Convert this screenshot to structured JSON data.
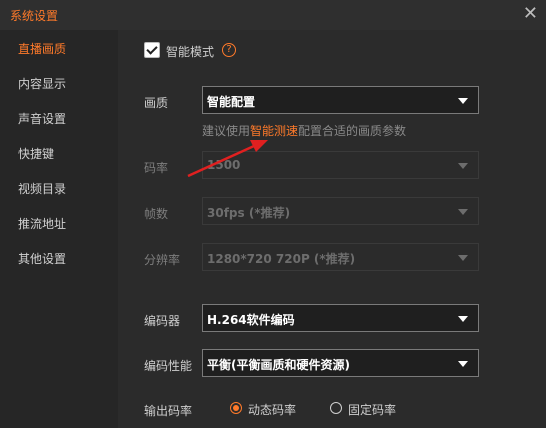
{
  "window": {
    "title": "系统设置",
    "close_glyph": "✕"
  },
  "sidebar": {
    "items": [
      {
        "label": "直播画质",
        "active": true
      },
      {
        "label": "内容显示"
      },
      {
        "label": "声音设置"
      },
      {
        "label": "快捷键"
      },
      {
        "label": "视频目录"
      },
      {
        "label": "推流地址"
      },
      {
        "label": "其他设置"
      }
    ]
  },
  "smart_mode": {
    "label": "智能模式",
    "checked": true,
    "help_glyph": "?"
  },
  "quality": {
    "label": "画质",
    "value": "智能配置",
    "hint_prefix": "建议使用",
    "hint_link": "智能测速",
    "hint_suffix": "配置合适的画质参数"
  },
  "bitrate": {
    "label": "码率",
    "value": "1500"
  },
  "fps": {
    "label": "帧数",
    "value": "30fps (*推荐)"
  },
  "resolution": {
    "label": "分辨率",
    "value": "1280*720 720P (*推荐)"
  },
  "encoder": {
    "label": "编码器",
    "value": "H.264软件编码"
  },
  "encoder_perf": {
    "label": "编码性能",
    "value": "平衡(平衡画质和硬件资源)"
  },
  "output_bitrate": {
    "label": "输出码率",
    "options": [
      {
        "label": "动态码率",
        "selected": true
      },
      {
        "label": "固定码率"
      }
    ]
  },
  "colors": {
    "accent": "#ff7a2a",
    "annotation_arrow": "#e02020"
  }
}
